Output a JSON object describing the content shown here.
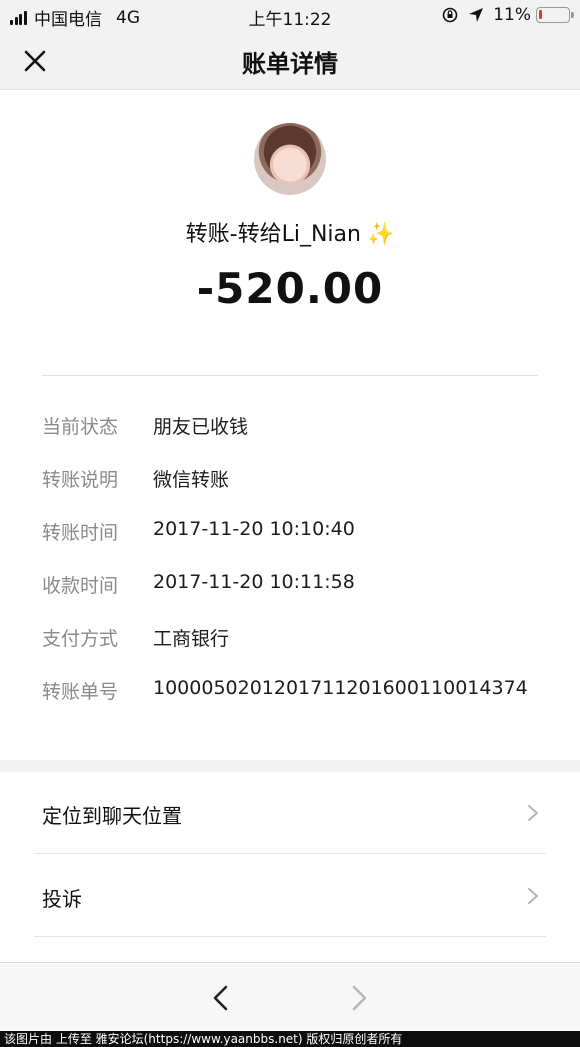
{
  "status_bar": {
    "carrier": "中国电信",
    "network": "4G",
    "time": "上午11:22",
    "battery_percent": "11%",
    "battery_level": 0.11,
    "battery_color": "#e8332a"
  },
  "nav": {
    "title": "账单详情",
    "close_icon": "close-icon"
  },
  "transaction": {
    "payee_label": "转账-转给Li_Nian",
    "payee_emoji": "✨",
    "amount": "-520.00"
  },
  "details": [
    {
      "label": "当前状态",
      "value": "朋友已收钱"
    },
    {
      "label": "转账说明",
      "value": "微信转账"
    },
    {
      "label": "转账时间",
      "value": "2017-11-20 10:10:40"
    },
    {
      "label": "收款时间",
      "value": "2017-11-20 10:11:58"
    },
    {
      "label": "支付方式",
      "value": "工商银行"
    },
    {
      "label": "转账单号",
      "value": "1000050201201711201600110014374"
    }
  ],
  "actions": [
    {
      "label": "定位到聊天位置",
      "icon": "chevron-right-icon"
    },
    {
      "label": "投诉",
      "icon": "chevron-right-icon"
    }
  ],
  "toolbar": {
    "back_icon": "chevron-left-icon",
    "forward_icon": "chevron-right-icon"
  },
  "caption": "该图片由  上传至 雅安论坛(https://www.yaanbbs.net) 版权归原创者所有"
}
